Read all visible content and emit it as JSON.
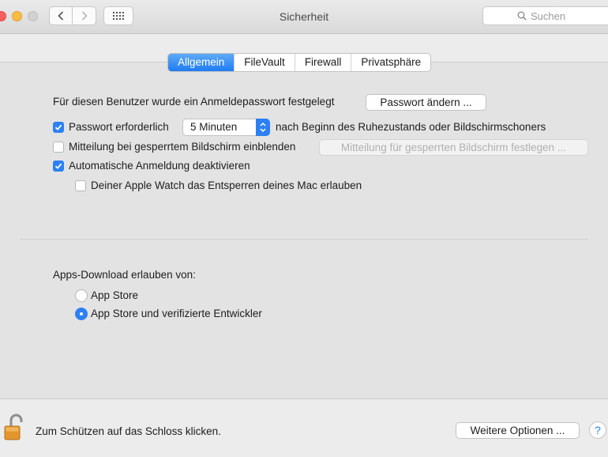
{
  "window": {
    "title": "Sicherheit"
  },
  "toolbar": {
    "search_placeholder": "Suchen"
  },
  "tabs": [
    {
      "label": "Allgemein",
      "active": true
    },
    {
      "label": "FileVault",
      "active": false
    },
    {
      "label": "Firewall",
      "active": false
    },
    {
      "label": "Privatsphäre",
      "active": false
    }
  ],
  "general": {
    "password_set_text": "Für diesen Benutzer wurde ein Anmeldepasswort festgelegt",
    "change_password_button": "Passwort ändern ...",
    "require_password": {
      "label": "Passwort erforderlich",
      "checked": true
    },
    "delay_select_value": "5 Minuten",
    "after_sleep_text": "nach Beginn des Ruhezustands oder Bildschirmschoners",
    "lock_message": {
      "label": "Mitteilung bei gesperrtem Bildschirm einblenden",
      "checked": false
    },
    "lock_message_button": "Mitteilung für gesperrten Bildschirm festlegen ...",
    "disable_auto_login": {
      "label": "Automatische Anmeldung deaktivieren",
      "checked": true
    },
    "apple_watch": {
      "label": "Deiner Apple Watch das Entsperren deines Mac erlauben",
      "checked": false
    }
  },
  "downloads": {
    "heading": "Apps-Download erlauben von:",
    "options": [
      {
        "label": "App Store",
        "selected": false
      },
      {
        "label": "App Store und verifizierte Entwickler",
        "selected": true
      }
    ]
  },
  "footer": {
    "lock_text": "Zum Schützen auf das Schloss klicken.",
    "advanced_button": "Weitere Optionen ...",
    "help_label": "?"
  },
  "colors": {
    "accent": "#2c80f3",
    "lock_body": "#e3962c"
  }
}
